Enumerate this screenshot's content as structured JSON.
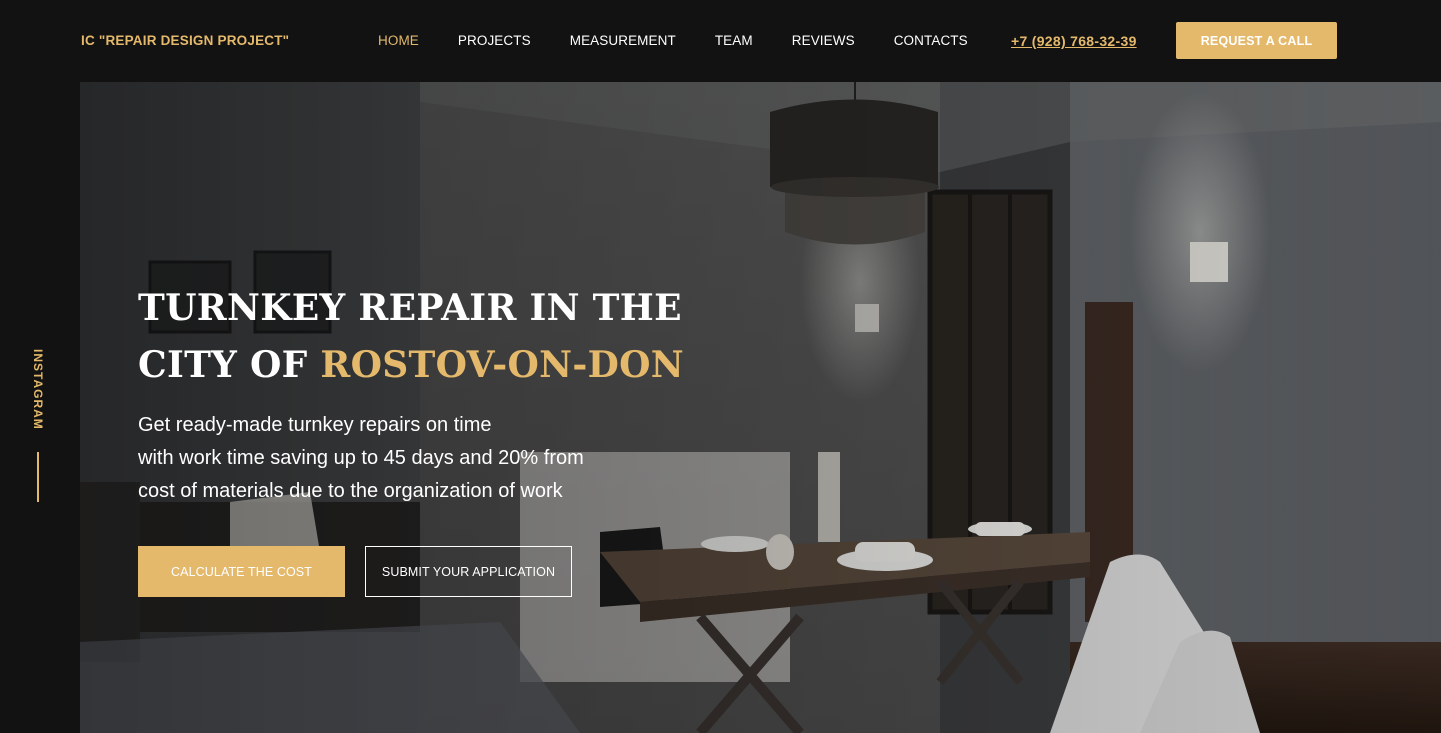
{
  "header": {
    "logo": "IC \"REPAIR DESIGN PROJECT\"",
    "nav": [
      {
        "label": "HOME",
        "active": true
      },
      {
        "label": "PROJECTS",
        "active": false
      },
      {
        "label": "MEASUREMENT",
        "active": false
      },
      {
        "label": "TEAM",
        "active": false
      },
      {
        "label": "REVIEWS",
        "active": false
      },
      {
        "label": "CONTACTS",
        "active": false
      }
    ],
    "phone": "+7 (928) 768-32-39",
    "cta_label": "REQUEST A CALL"
  },
  "sidebar": {
    "instagram_label": "INSTAGRAM"
  },
  "hero": {
    "title_line1": "TURNKEY REPAIR IN THE",
    "title_line2_prefix": "CITY OF ",
    "title_line2_accent": "ROSTOV-ON-DON",
    "description_lines": [
      "Get ready-made turnkey repairs on time",
      "with work time saving up to 45 days and 20% from",
      "cost of materials due to the organization of work"
    ],
    "primary_button": "CALCULATE THE COST",
    "secondary_button": "SUBMIT YOUR APPLICATION"
  },
  "colors": {
    "accent": "#e4b96b",
    "header_bg": "#121212",
    "text": "#ffffff"
  }
}
